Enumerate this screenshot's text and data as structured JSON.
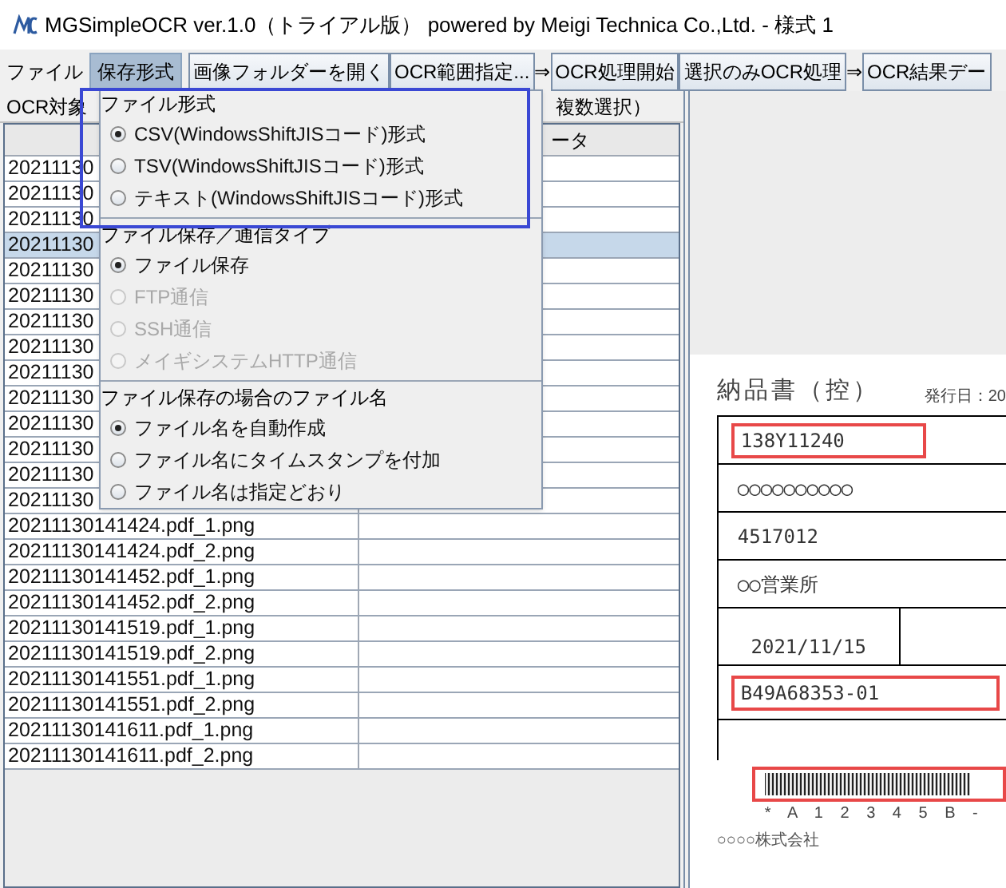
{
  "window": {
    "title": "MGSimpleOCR ver.1.0（トライアル版） powered by Meigi Technica Co.,Ltd. - 様式 1"
  },
  "menubar": [
    {
      "label": "ファイル",
      "selected": false
    },
    {
      "label": "保存形式",
      "selected": true
    }
  ],
  "toolbar": [
    {
      "kind": "button",
      "label": "画像フォルダーを開く"
    },
    {
      "kind": "button",
      "label": "OCR範囲指定..."
    },
    {
      "kind": "arrow",
      "label": "⇒"
    },
    {
      "kind": "button",
      "label": "OCR処理開始"
    },
    {
      "kind": "button",
      "label": "選択のみOCR処理"
    },
    {
      "kind": "arrow",
      "label": "⇒"
    },
    {
      "kind": "button",
      "label": "OCR結果デー"
    }
  ],
  "file_list": {
    "title_left": "OCR対象",
    "title_right": "複数選択）",
    "column_2_header": "ータ",
    "rows": [
      {
        "name": "20211130",
        "selected": false
      },
      {
        "name": "20211130",
        "selected": false
      },
      {
        "name": "20211130",
        "selected": false
      },
      {
        "name": "20211130",
        "selected": true
      },
      {
        "name": "20211130",
        "selected": false
      },
      {
        "name": "20211130",
        "selected": false
      },
      {
        "name": "20211130",
        "selected": false
      },
      {
        "name": "20211130",
        "selected": false
      },
      {
        "name": "20211130",
        "selected": false
      },
      {
        "name": "20211130",
        "selected": false
      },
      {
        "name": "20211130",
        "selected": false
      },
      {
        "name": "20211130",
        "selected": false
      },
      {
        "name": "20211130",
        "selected": false
      },
      {
        "name": "20211130",
        "selected": false
      },
      {
        "name": "20211130141424.pdf_1.png",
        "selected": false
      },
      {
        "name": "20211130141424.pdf_2.png",
        "selected": false
      },
      {
        "name": "20211130141452.pdf_1.png",
        "selected": false
      },
      {
        "name": "20211130141452.pdf_2.png",
        "selected": false
      },
      {
        "name": "20211130141519.pdf_1.png",
        "selected": false
      },
      {
        "name": "20211130141519.pdf_2.png",
        "selected": false
      },
      {
        "name": "20211130141551.pdf_1.png",
        "selected": false
      },
      {
        "name": "20211130141551.pdf_2.png",
        "selected": false
      },
      {
        "name": "20211130141611.pdf_1.png",
        "selected": false
      },
      {
        "name": "20211130141611.pdf_2.png",
        "selected": false
      }
    ]
  },
  "menu": {
    "sections": [
      {
        "heading": "ファイル形式",
        "options": [
          {
            "label": "CSV(WindowsShiftJISコード)形式",
            "selected": true,
            "disabled": false
          },
          {
            "label": "TSV(WindowsShiftJISコード)形式",
            "selected": false,
            "disabled": false
          },
          {
            "label": "テキスト(WindowsShiftJISコード)形式",
            "selected": false,
            "disabled": false
          }
        ]
      },
      {
        "heading": "ファイル保存／通信タイプ",
        "options": [
          {
            "label": "ファイル保存",
            "selected": true,
            "disabled": false
          },
          {
            "label": "FTP通信",
            "selected": false,
            "disabled": true
          },
          {
            "label": "SSH通信",
            "selected": false,
            "disabled": true
          },
          {
            "label": "メイギシステムHTTP通信",
            "selected": false,
            "disabled": true
          }
        ]
      },
      {
        "heading": "ファイル保存の場合のファイル名",
        "options": [
          {
            "label": "ファイル名を自動作成",
            "selected": true,
            "disabled": false
          },
          {
            "label": "ファイル名にタイムスタンプを付加",
            "selected": false,
            "disabled": false
          },
          {
            "label": "ファイル名は指定どおり",
            "selected": false,
            "disabled": false
          }
        ]
      }
    ]
  },
  "preview": {
    "title": "納品書（控）",
    "issue_date": "発行日：20",
    "fields": [
      {
        "value": "138Y11240",
        "marked": true
      },
      {
        "value": "○○○○○○○○○○",
        "marked": false
      },
      {
        "value": "4517012",
        "marked": false
      },
      {
        "value": "○○営業所",
        "marked": false
      },
      {
        "value": "2021/11/15",
        "marked": false
      },
      {
        "value": "B49A68353-01",
        "marked": true
      }
    ],
    "barcode_caption": "* A 1 2 3 4 5 B -",
    "company": "○○○○株式会社"
  }
}
